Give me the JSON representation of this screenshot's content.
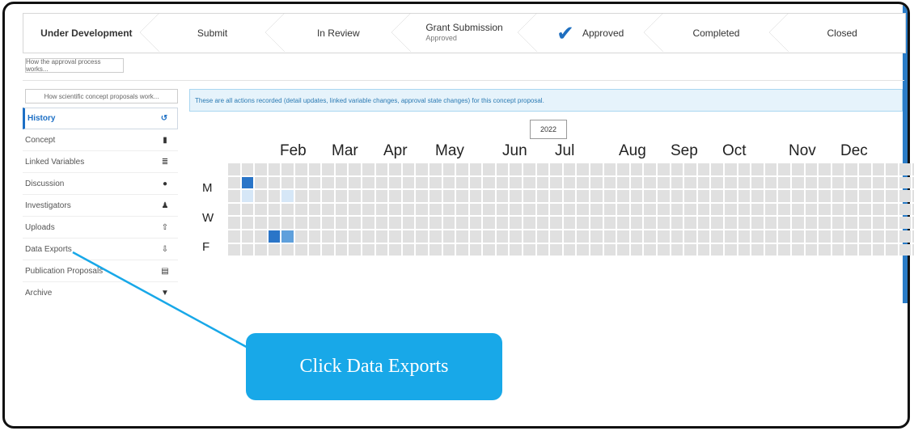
{
  "stepper": {
    "steps": [
      {
        "title": "Under Development",
        "sub": ""
      },
      {
        "title": "Submit",
        "sub": ""
      },
      {
        "title": "In Review",
        "sub": ""
      },
      {
        "title": "Grant Submission",
        "sub": "Approved"
      },
      {
        "title": "Approved",
        "sub": ""
      },
      {
        "title": "Completed",
        "sub": ""
      },
      {
        "title": "Closed",
        "sub": ""
      }
    ]
  },
  "buttons": {
    "approval_help": "How the approval process works...",
    "proposal_help": "How scientific concept proposals work..."
  },
  "sidebar": {
    "items": [
      {
        "label": "History",
        "icon": "history-icon",
        "active": true
      },
      {
        "label": "Concept",
        "icon": "file-icon"
      },
      {
        "label": "Linked Variables",
        "icon": "database-icon"
      },
      {
        "label": "Discussion",
        "icon": "comment-icon"
      },
      {
        "label": "Investigators",
        "icon": "user-icon"
      },
      {
        "label": "Uploads",
        "icon": "upload-icon"
      },
      {
        "label": "Data Exports",
        "icon": "download-icon"
      },
      {
        "label": "Publication Proposals",
        "icon": "book-icon"
      },
      {
        "label": "Archive",
        "icon": "trash-icon"
      }
    ]
  },
  "info_text": "These are all actions recorded (detail updates, linked variable changes, approval state changes) for this concept proposal.",
  "year": "2022",
  "calendar": {
    "months": [
      "Feb",
      "Mar",
      "Apr",
      "May",
      "Jun",
      "Jul",
      "Aug",
      "Sep",
      "Oct",
      "Nov",
      "Dec"
    ],
    "day_labels": [
      "M",
      "W",
      "F"
    ],
    "weeks": 52,
    "activity": [
      {
        "week": 1,
        "day": 1,
        "level": 3
      },
      {
        "week": 1,
        "day": 2,
        "level": 1
      },
      {
        "week": 4,
        "day": 2,
        "level": 1
      },
      {
        "week": 3,
        "day": 5,
        "level": 3
      },
      {
        "week": 4,
        "day": 5,
        "level": 2
      }
    ]
  },
  "callout": "Click Data Exports",
  "colors": {
    "accent": "#1c6fc5",
    "callout": "#18a8e8",
    "info_bg": "#e6f3fb"
  }
}
